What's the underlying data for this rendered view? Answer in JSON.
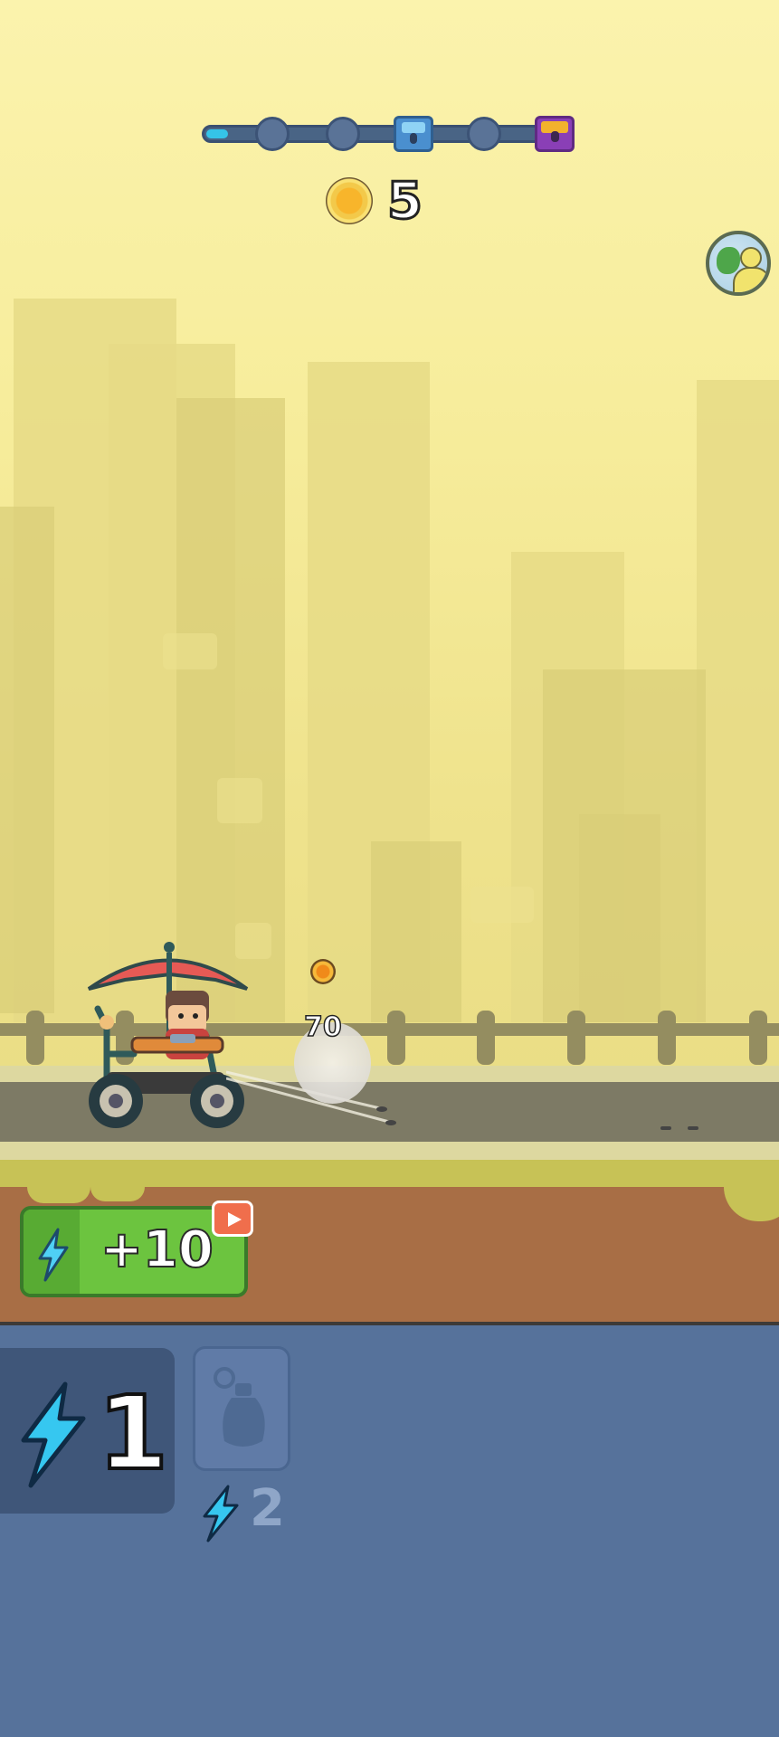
{
  "hud": {
    "progress": {
      "fraction": 0.06,
      "nodes": [
        "node",
        "node",
        "blue-chest",
        "node",
        "gold-chest"
      ]
    },
    "coins": "5"
  },
  "combat": {
    "damage": "70"
  },
  "boost_button": {
    "label": "+10",
    "has_video_ad": true
  },
  "abilities": {
    "energy": "1",
    "grenade_cost": "2"
  },
  "colors": {
    "sky": "#fbf3ad",
    "panel": "#56729b",
    "boost_green": "#6cc43f",
    "energy_blue": "#36c7f0",
    "dirt": "#a86e45"
  }
}
